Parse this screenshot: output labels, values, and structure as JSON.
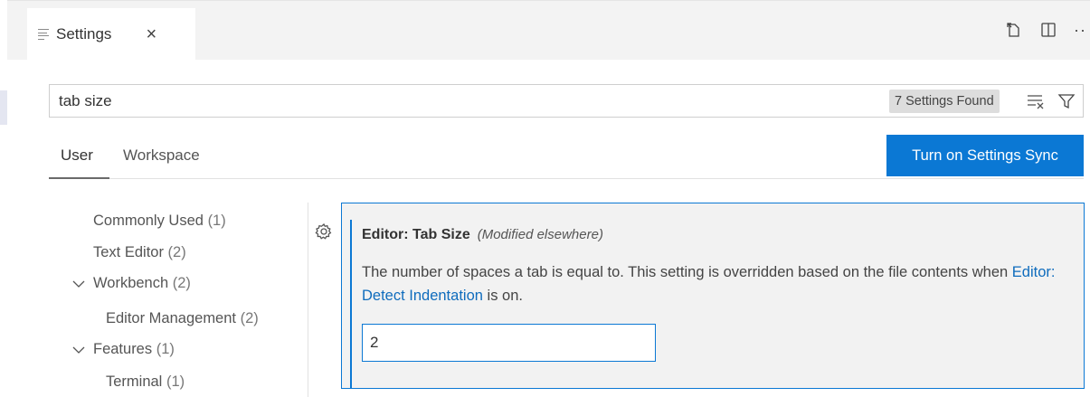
{
  "tab": {
    "label": "Settings",
    "close": "×",
    "icon": "settings-doc-icon"
  },
  "editor_actions": {
    "open_json_icon": "open-settings-json-icon",
    "split_icon": "split-editor-icon",
    "more_label": "···"
  },
  "search": {
    "value": "tab size",
    "results_badge": "7 Settings Found",
    "clear_icon": "clear-filter-icon",
    "filter_icon": "filter-icon"
  },
  "scope_tabs": {
    "user": "User",
    "workspace": "Workspace"
  },
  "sync_button": "Turn on Settings Sync",
  "toc": [
    {
      "label": "Commonly Used",
      "count": "(1)"
    },
    {
      "label": "Text Editor",
      "count": "(2)"
    },
    {
      "label": "Workbench",
      "count": "(2)",
      "expanded": true
    },
    {
      "label": "Editor Management",
      "count": "(2)"
    },
    {
      "label": "Features",
      "count": "(1)",
      "expanded": true
    },
    {
      "label": "Terminal",
      "count": "(1)"
    }
  ],
  "setting": {
    "category": "Editor: ",
    "name": "Tab Size",
    "modified_note": "(Modified elsewhere)",
    "desc_part1": "The number of spaces a tab is equal to. This setting is overridden based on the file contents when ",
    "desc_link": "Editor: Detect Indentation",
    "desc_part2": " is on.",
    "value": "2"
  },
  "colors": {
    "accent": "#0b78d4",
    "link": "#0f6cbd",
    "badge_bg": "#dddddd",
    "selected_setting_bg": "#f2f2f2"
  }
}
